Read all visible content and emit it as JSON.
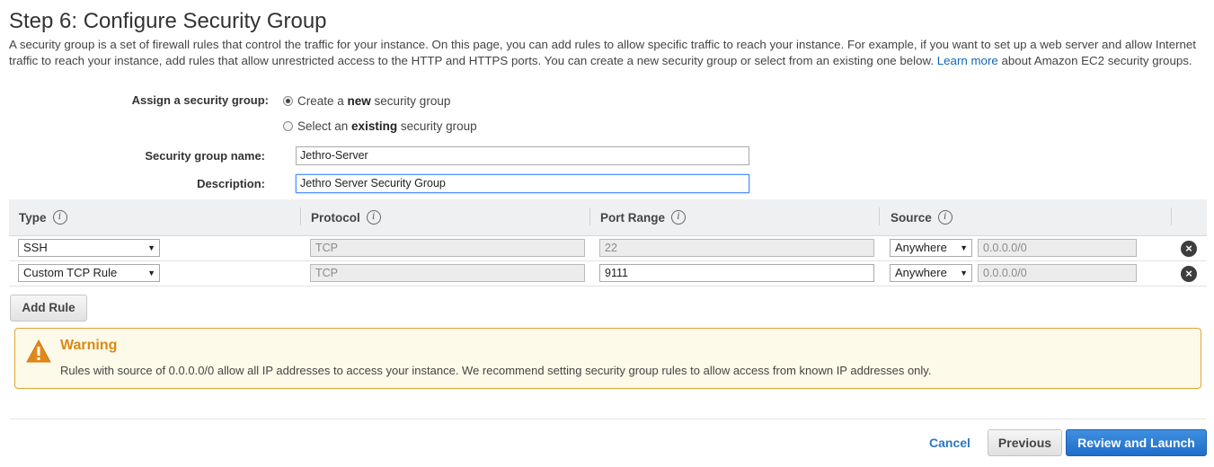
{
  "page": {
    "title": "Step 6: Configure Security Group",
    "intro_text": "A security group is a set of firewall rules that control the traffic for your instance. On this page, you can add rules to allow specific traffic to reach your instance. For example, if you want to set up a web server and allow Internet traffic to reach your instance, add rules that allow unrestricted access to the HTTP and HTTPS ports. You can create a new security group or select from an existing one below. ",
    "learn_more": "Learn more",
    "intro_tail": " about Amazon EC2 security groups."
  },
  "assign": {
    "label": "Assign a security group:",
    "option_new_prefix": "Create a ",
    "option_new_bold": "new",
    "option_new_suffix": " security group",
    "option_existing_prefix": "Select an ",
    "option_existing_bold": "existing",
    "option_existing_suffix": " security group",
    "selected": "new"
  },
  "form": {
    "name_label": "Security group name:",
    "name_value": "Jethro-Server",
    "desc_label": "Description:",
    "desc_value": "Jethro Server Security Group"
  },
  "rules_table": {
    "columns": [
      "Type",
      "Protocol",
      "Port Range",
      "Source"
    ],
    "rows": [
      {
        "type": "SSH",
        "protocol": "TCP",
        "port": "22",
        "source": "Anywhere",
        "cidr": "0.0.0.0/0"
      },
      {
        "type": "Custom TCP Rule",
        "protocol": "TCP",
        "port": "9111",
        "source": "Anywhere",
        "cidr": "0.0.0.0/0"
      }
    ],
    "add_rule": "Add Rule"
  },
  "warning": {
    "title": "Warning",
    "text": "Rules with source of 0.0.0.0/0 allow all IP addresses to access your instance. We recommend setting security group rules to allow access from known IP addresses only."
  },
  "footer": {
    "cancel": "Cancel",
    "previous": "Previous",
    "review_launch": "Review and Launch"
  },
  "icons": {
    "info": "info-icon",
    "remove": "remove-icon",
    "warning": "warning-triangle-icon",
    "dropdown": "dropdown-arrow-icon"
  },
  "colors": {
    "accent": "#1f6ec9",
    "link": "#1166bb",
    "warning": "#d88a13"
  }
}
